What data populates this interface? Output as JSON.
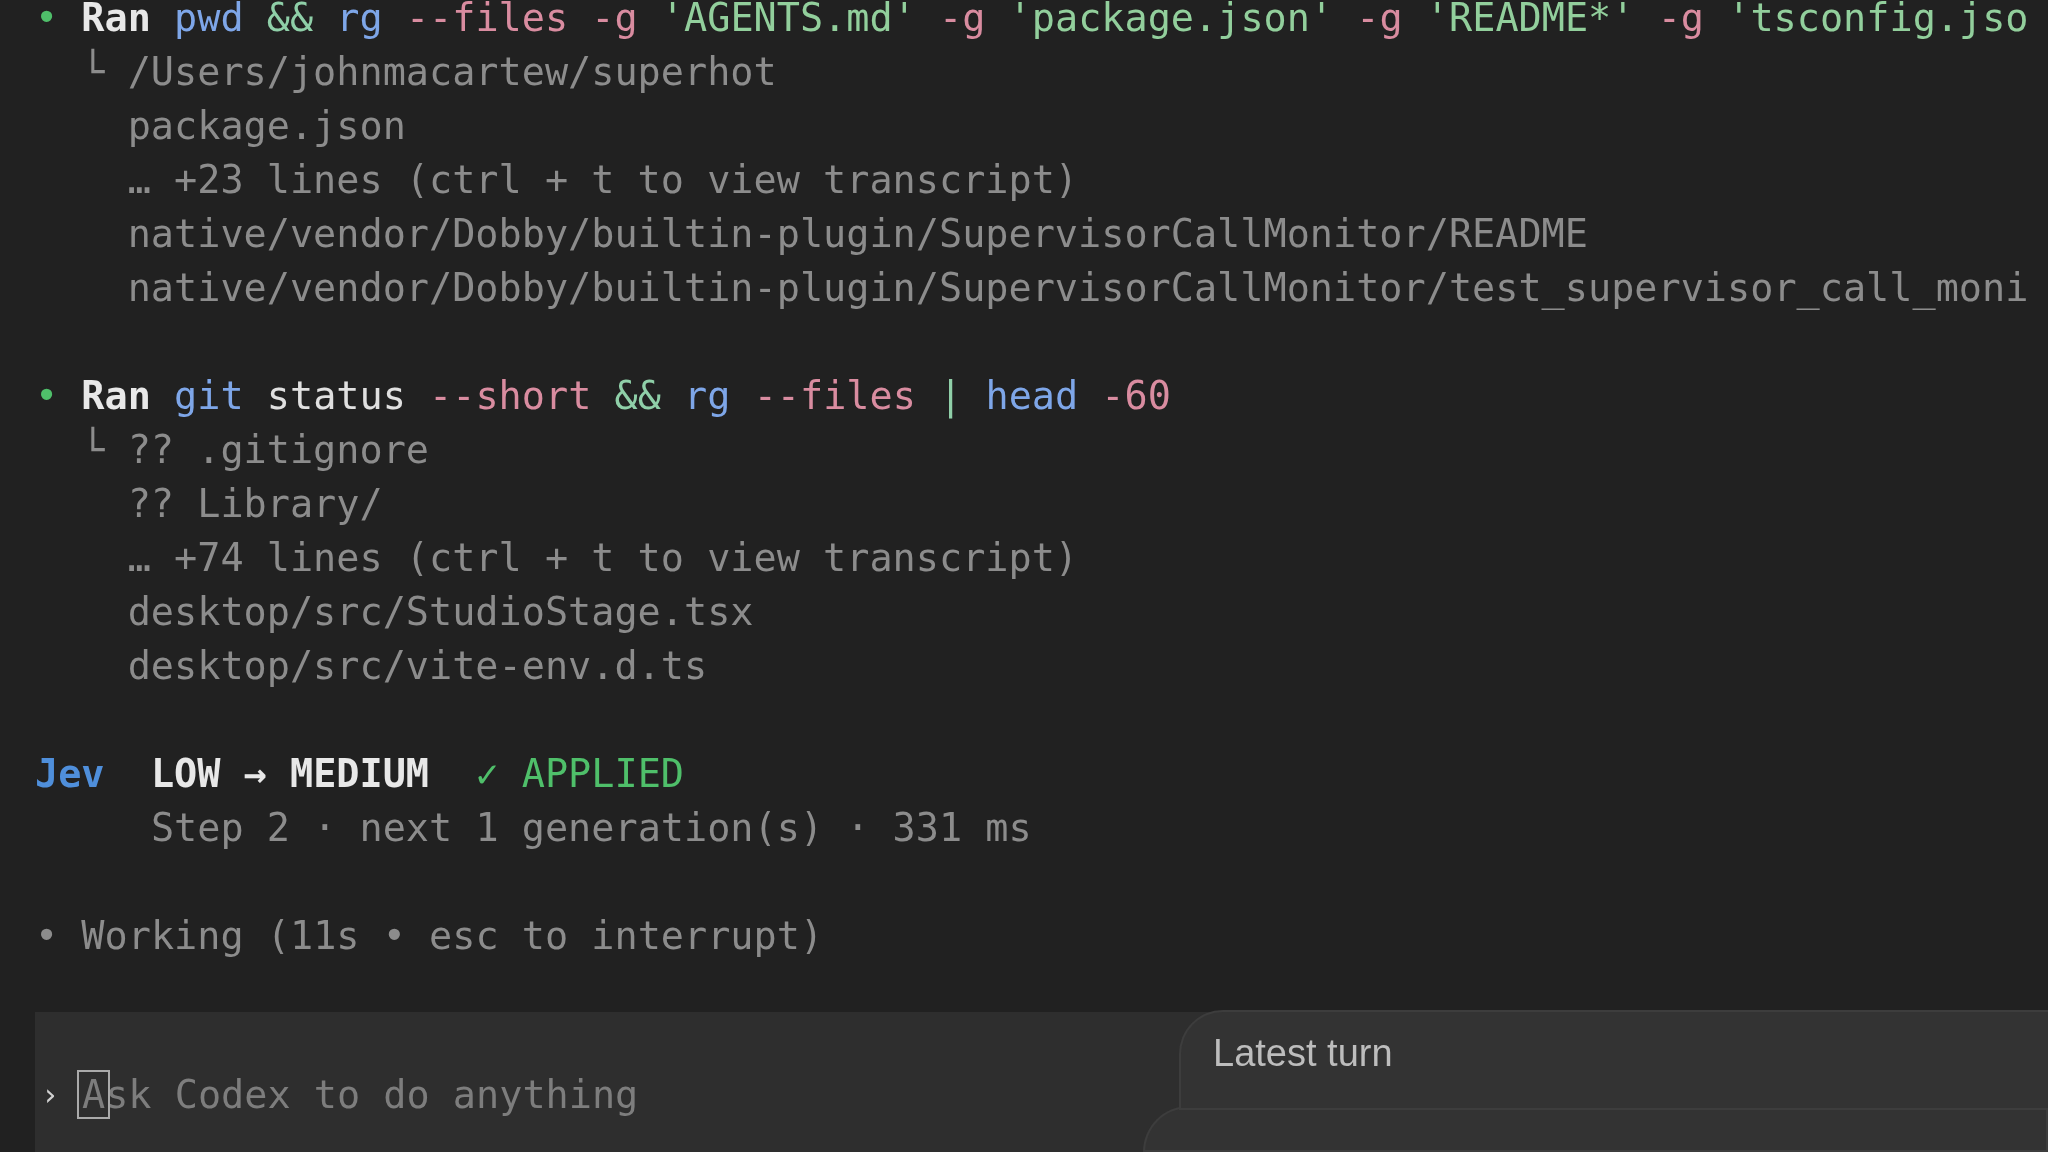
{
  "transcript": [
    {
      "kind": "command",
      "bullet": "•",
      "label": "Ran",
      "tokens": [
        {
          "kind": "cmd",
          "text": "pwd"
        },
        {
          "kind": "op",
          "text": "&&"
        },
        {
          "kind": "cmd",
          "text": "rg"
        },
        {
          "kind": "flag",
          "text": "--files"
        },
        {
          "kind": "flag",
          "text": "-g"
        },
        {
          "kind": "string",
          "text": "'AGENTS.md'"
        },
        {
          "kind": "flag",
          "text": "-g"
        },
        {
          "kind": "string",
          "text": "'package.json'"
        },
        {
          "kind": "flag",
          "text": "-g"
        },
        {
          "kind": "string",
          "text": "'README*'"
        },
        {
          "kind": "flag",
          "text": "-g"
        },
        {
          "kind": "string",
          "text": "'tsconfig.jso"
        }
      ],
      "branch": "└",
      "output": [
        "/Users/johnmacartew/superhot",
        "package.json",
        "… +23 lines (ctrl + t to view transcript)",
        "native/vendor/Dobby/builtin-plugin/SupervisorCallMonitor/README",
        "native/vendor/Dobby/builtin-plugin/SupervisorCallMonitor/test_supervisor_call_moni"
      ]
    },
    {
      "kind": "command",
      "bullet": "•",
      "label": "Ran",
      "tokens": [
        {
          "kind": "cmd",
          "text": "git"
        },
        {
          "kind": "arg",
          "text": "status"
        },
        {
          "kind": "flag",
          "text": "--short"
        },
        {
          "kind": "op",
          "text": "&&"
        },
        {
          "kind": "cmd",
          "text": "rg"
        },
        {
          "kind": "flag",
          "text": "--files"
        },
        {
          "kind": "op",
          "text": "|"
        },
        {
          "kind": "cmd",
          "text": "head"
        },
        {
          "kind": "flag",
          "text": "-60"
        }
      ],
      "branch": "└",
      "output": [
        "?? .gitignore",
        "?? Library/",
        "… +74 lines (ctrl + t to view transcript)",
        "desktop/src/StudioStage.tsx",
        "desktop/src/vite-env.d.ts"
      ]
    },
    {
      "kind": "event",
      "source": "Jev",
      "change": "LOW → MEDIUM",
      "result": "✓ APPLIED",
      "detail": "Step 2 · next 1 generation(s) · 331 ms"
    },
    {
      "kind": "status",
      "bullet": "•",
      "text": "Working (11s • esc to interrupt)"
    }
  ],
  "composer": {
    "prompt": "›",
    "placeholder": "Ask Codex to do anything"
  },
  "popover": {
    "title": "Latest turn"
  }
}
